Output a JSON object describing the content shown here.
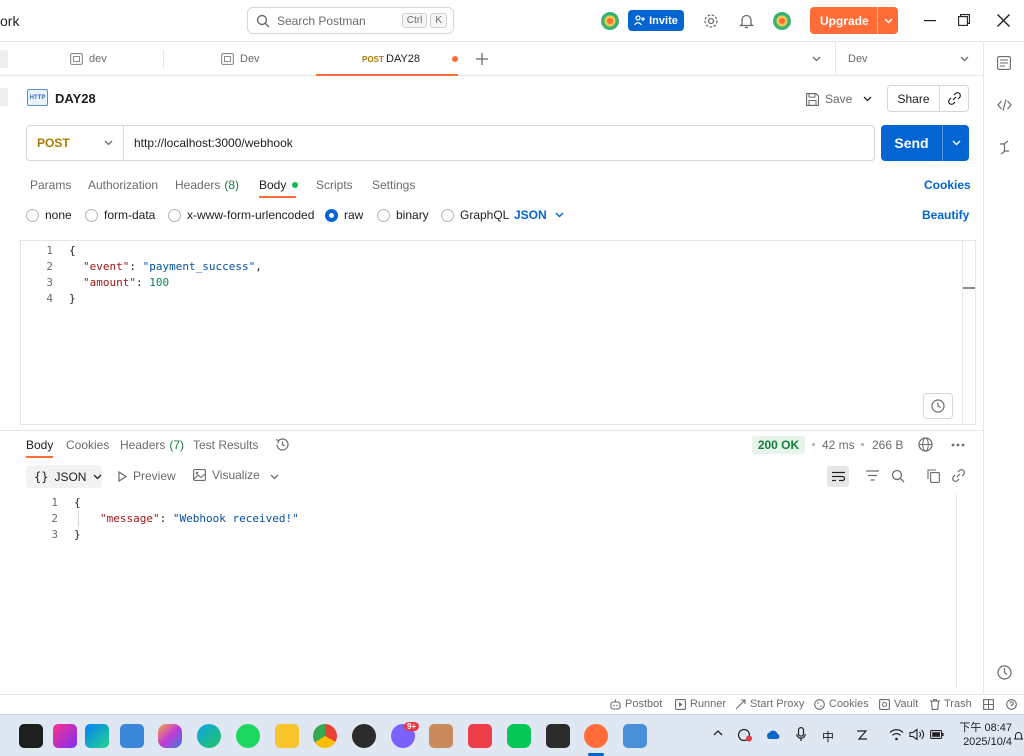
{
  "titlebar": {
    "app_title_fragment": "ork",
    "search_placeholder": "Search Postman",
    "search_kbd_ctrl": "Ctrl",
    "search_kbd_k": "K",
    "invite_label": "Invite",
    "upgrade_label": "Upgrade"
  },
  "tabs": {
    "items": [
      {
        "method": "",
        "label": "dev"
      },
      {
        "method": "",
        "label": "Dev"
      },
      {
        "method": "POST",
        "label": "DAY28"
      }
    ],
    "environment": "Dev"
  },
  "request": {
    "icon_text": "HTTP",
    "name": "DAY28",
    "save_label": "Save",
    "share_label": "Share",
    "method": "POST",
    "url": "http://localhost:3000/webhook",
    "send_label": "Send",
    "subtabs": {
      "params": "Params",
      "authorization": "Authorization",
      "headers": "Headers",
      "headers_count": "(8)",
      "body": "Body",
      "scripts": "Scripts",
      "settings": "Settings",
      "cookies": "Cookies"
    },
    "body_types": {
      "none": "none",
      "form_data": "form-data",
      "urlencoded": "x-www-form-urlencoded",
      "raw": "raw",
      "binary": "binary",
      "graphql": "GraphQL",
      "format": "JSON",
      "beautify": "Beautify"
    },
    "body_lines": {
      "n1": "1",
      "n2": "2",
      "n3": "3",
      "n4": "4",
      "l1": "{",
      "l2_key": "\"event\"",
      "l2_sep": ": ",
      "l2_val": "\"payment_success\"",
      "l2_end": ",",
      "l3_key": "\"amount\"",
      "l3_sep": ": ",
      "l3_val": "100",
      "l4": "}"
    }
  },
  "response": {
    "tabs": {
      "body": "Body",
      "cookies": "Cookies",
      "headers": "Headers",
      "headers_count": "(7)",
      "test_results": "Test Results"
    },
    "status": "200 OK",
    "time": "42 ms",
    "size": "266 B",
    "format": "JSON",
    "preview": "Preview",
    "visualize": "Visualize",
    "body_lines": {
      "n1": "1",
      "n2": "2",
      "n3": "3",
      "l1": "{",
      "l2_key": "\"message\"",
      "l2_sep": ": ",
      "l2_val": "\"Webhook received!\"",
      "l3": "}"
    }
  },
  "statusbar": {
    "postbot": "Postbot",
    "runner": "Runner",
    "start_proxy": "Start Proxy",
    "cookies": "Cookies",
    "vault": "Vault",
    "trash": "Trash"
  },
  "taskbar": {
    "time_prefix": "下午",
    "time": "08:47",
    "date": "2025/10/4",
    "ime": "中",
    "badge": "9+"
  },
  "colors": {
    "brand_orange": "#ff6c37",
    "primary_blue": "#0265d2",
    "status_green": "#167e3c",
    "post_method": "#ad7a03"
  }
}
